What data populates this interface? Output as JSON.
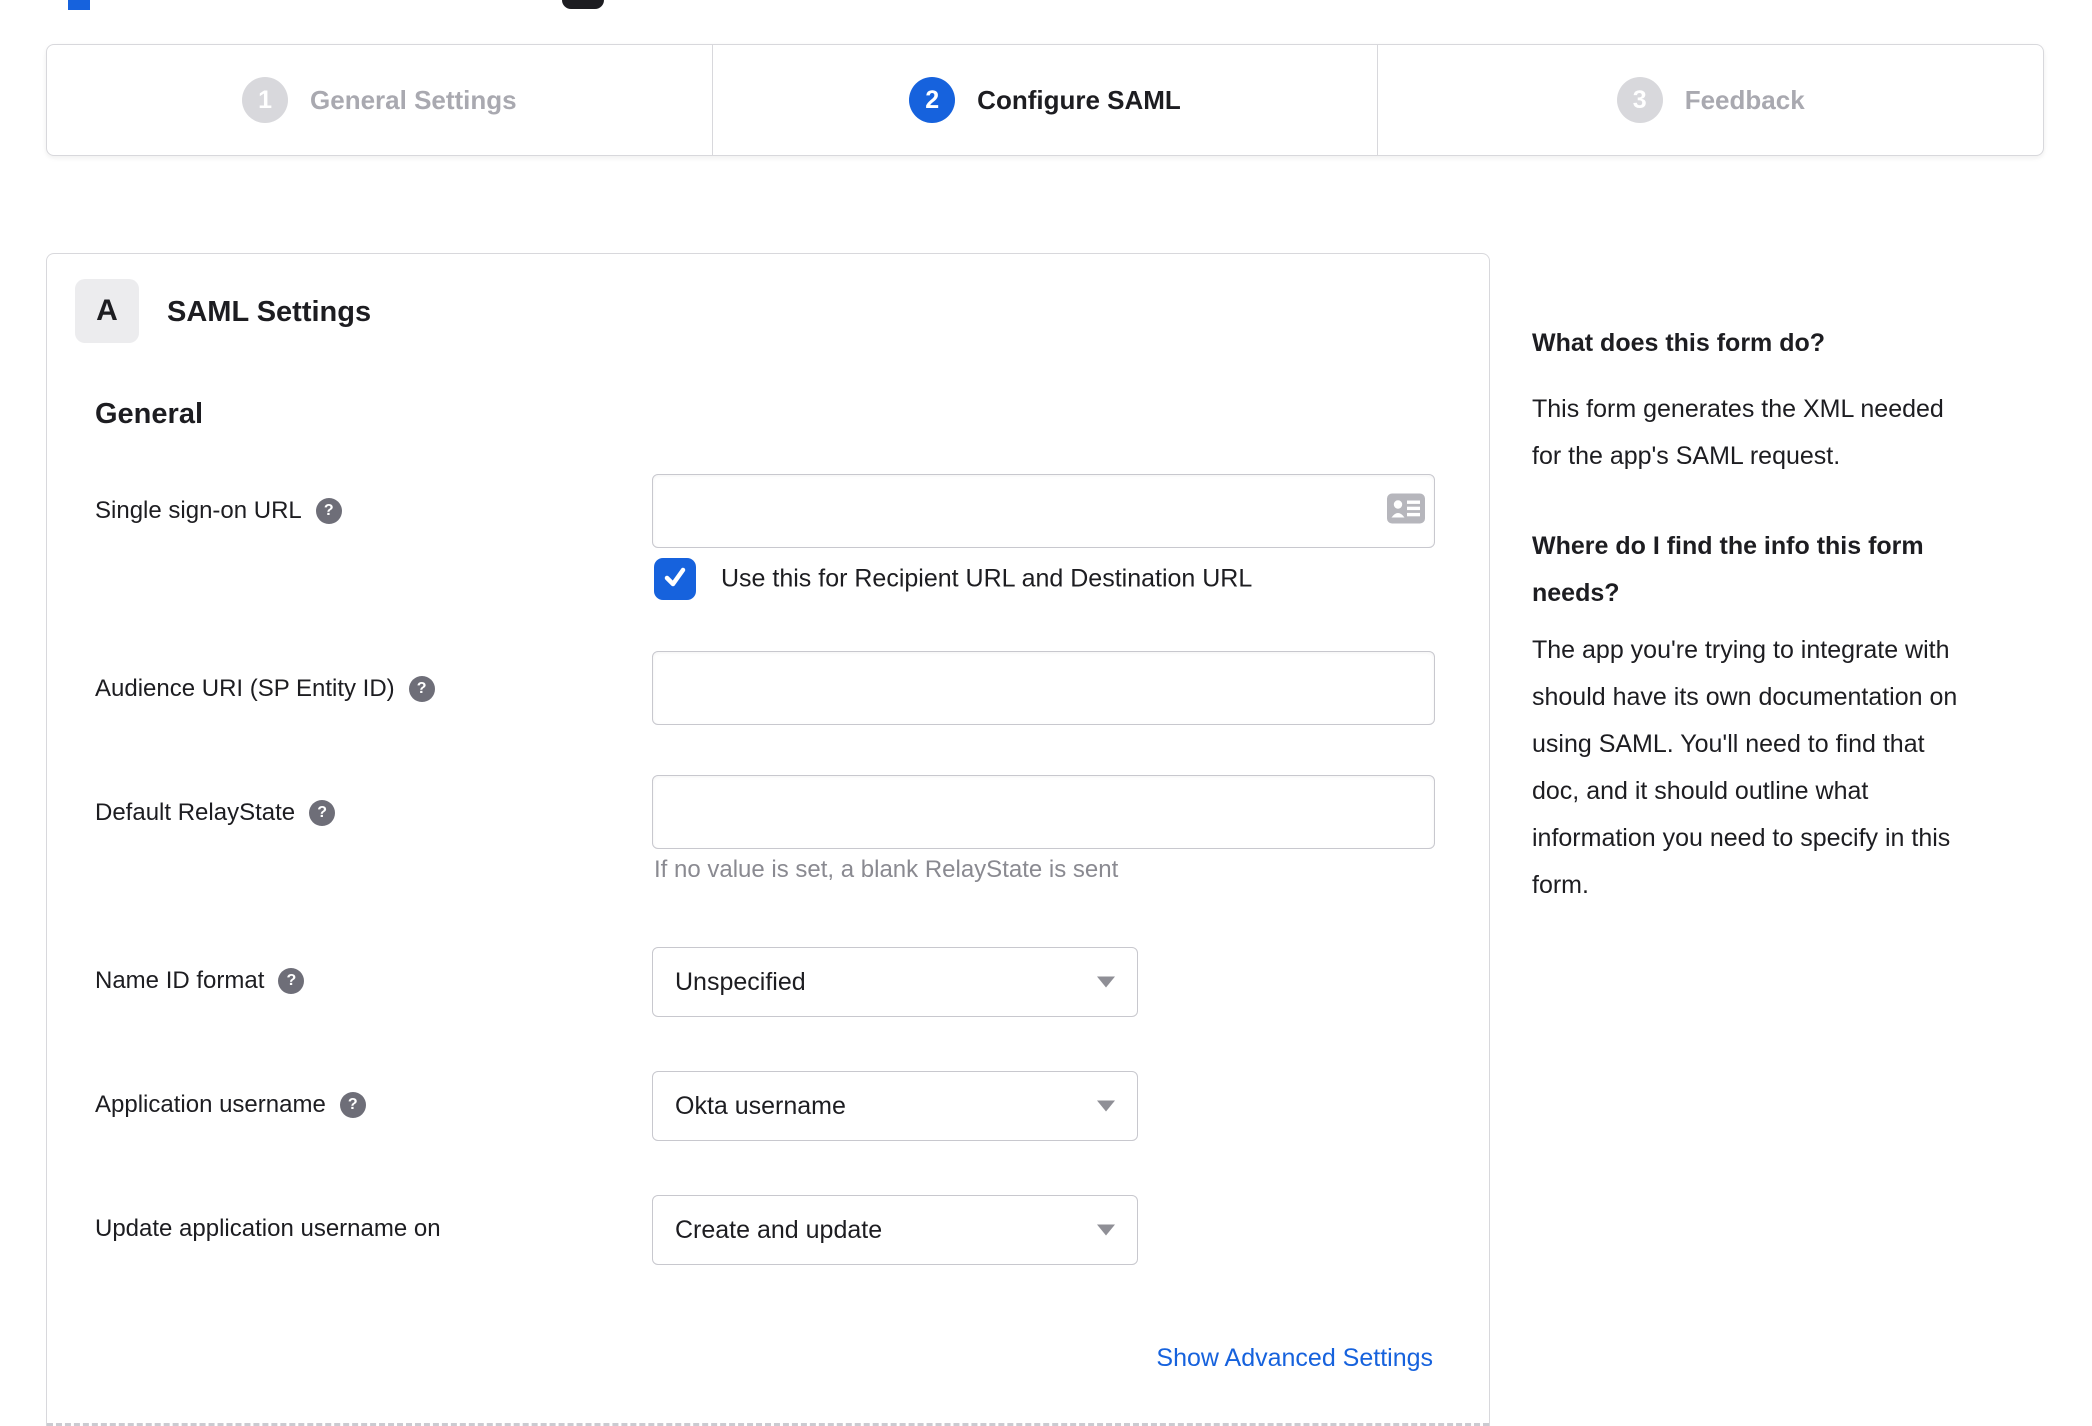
{
  "colors": {
    "accent_blue": "#1662dd",
    "inactive_gray": "#d8d8dc",
    "text_dark": "#1d1d21",
    "hint_gray": "#8a8a91"
  },
  "icons": {
    "help_glyph": "?"
  },
  "stepper": {
    "steps": [
      {
        "number": "1",
        "label": "General Settings",
        "state": "inactive"
      },
      {
        "number": "2",
        "label": "Configure SAML",
        "state": "active"
      },
      {
        "number": "3",
        "label": "Feedback",
        "state": "inactive"
      }
    ]
  },
  "panel": {
    "section_badge": "A",
    "section_title": "SAML Settings",
    "group_title": "General",
    "fields": [
      {
        "label": "Single sign-on URL",
        "type": "text",
        "value": "",
        "checkbox_checked": true,
        "checkbox_label": "Use this for Recipient URL and Destination URL"
      },
      {
        "label": "Audience URI (SP Entity ID)",
        "type": "text",
        "value": ""
      },
      {
        "label": "Default RelayState",
        "type": "text",
        "value": "",
        "hint": "If no value is set, a blank RelayState is sent"
      },
      {
        "label": "Name ID format",
        "type": "select",
        "value": "Unspecified"
      },
      {
        "label": "Application username",
        "type": "select",
        "value": "Okta username"
      },
      {
        "label": "Update application username on",
        "type": "select",
        "value": "Create and update"
      }
    ],
    "advanced_link": "Show Advanced Settings"
  },
  "sidebar": {
    "q1": "What does this form do?",
    "a1_lines": [
      "This form generates the XML needed",
      "for the app's SAML request."
    ],
    "q2_lines": [
      "Where do I find the info this form",
      "needs?"
    ],
    "a2_lines": [
      "The app you're trying to integrate with",
      "should have its own documentation on",
      "using SAML. You'll need to find that",
      "doc, and it should outline what",
      "information you need to specify in this",
      "form."
    ]
  }
}
